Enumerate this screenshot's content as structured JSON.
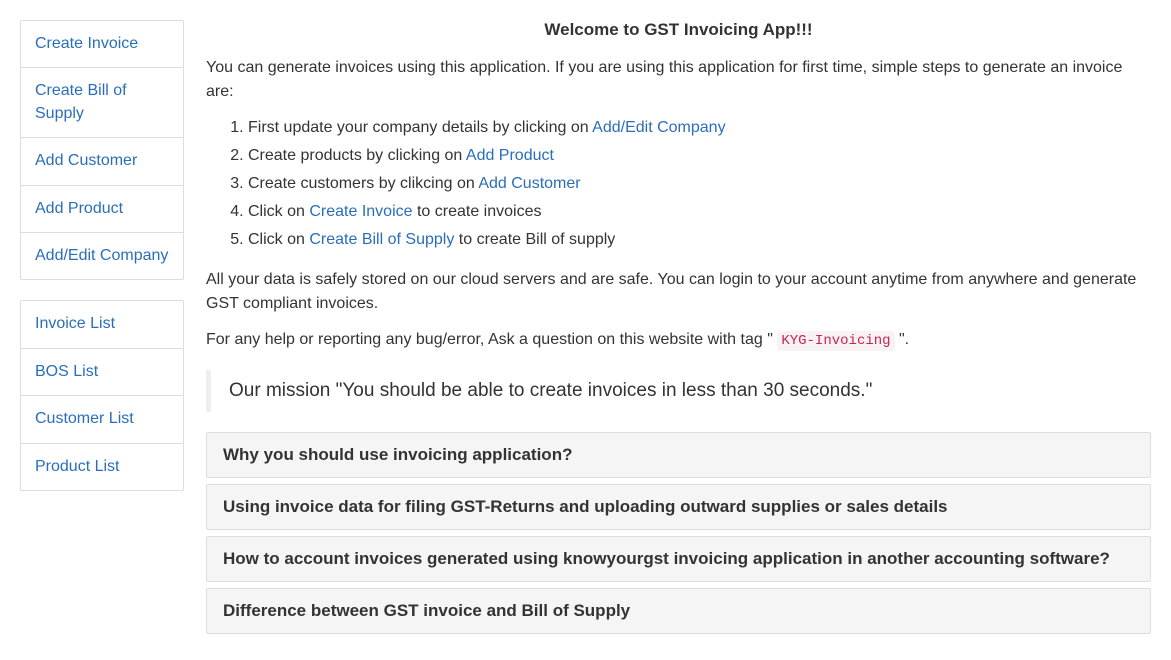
{
  "sidebar": {
    "group1": [
      {
        "label": "Create Invoice"
      },
      {
        "label": "Create Bill of Supply"
      },
      {
        "label": "Add Customer"
      },
      {
        "label": "Add Product"
      },
      {
        "label": "Add/Edit Company"
      }
    ],
    "group2": [
      {
        "label": "Invoice List"
      },
      {
        "label": "BOS List"
      },
      {
        "label": "Customer List"
      },
      {
        "label": "Product List"
      }
    ]
  },
  "main": {
    "title": "Welcome to GST Invoicing App!!!",
    "intro": "You can generate invoices using this application. If you are using this application for first time, simple steps to generate an invoice are:",
    "steps": {
      "s1_pre": "First update your company details by clicking on ",
      "s1_link": "Add/Edit Company",
      "s2_pre": "Create products by clicking on ",
      "s2_link": "Add Product",
      "s3_pre": "Create customers by clikcing on ",
      "s3_link": "Add Customer",
      "s4_pre": "Click on ",
      "s4_link": "Create Invoice",
      "s4_post": " to create invoices",
      "s5_pre": "Click on ",
      "s5_link": "Create Bill of Supply",
      "s5_post": " to create Bill of supply"
    },
    "storage_note": "All your data is safely stored on our cloud servers and are safe. You can login to your account anytime from anywhere and generate GST compliant invoices.",
    "help_pre": "For any help or reporting any bug/error, Ask a question on this website with tag \" ",
    "help_tag": "KYG-Invoicing",
    "help_post": " \".",
    "mission": "Our mission \"You should be able to create invoices in less than 30 seconds.\"",
    "accordion": [
      {
        "title": "Why you should use invoicing application?"
      },
      {
        "title": "Using invoice data for filing GST-Returns and uploading outward supplies or sales details"
      },
      {
        "title": "How to account invoices generated using knowyourgst invoicing application in another accounting software?"
      },
      {
        "title": "Difference between GST invoice and Bill of Supply"
      }
    ]
  }
}
